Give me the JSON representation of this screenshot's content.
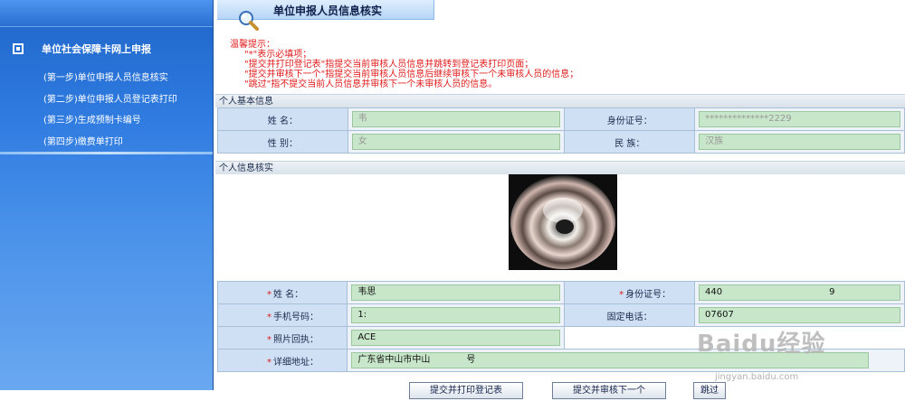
{
  "sidebar": {
    "heading": "单位社会保障卡网上申报",
    "items": [
      {
        "label": "(第一步)单位申报人员信息核实"
      },
      {
        "label": "(第二步)单位申报人员登记表打印"
      },
      {
        "label": "(第三步)生成预制卡编号"
      },
      {
        "label": "(第四步)缴费单打印"
      }
    ]
  },
  "header": {
    "title": "单位申报人员信息核实"
  },
  "tips": {
    "heading": "温馨提示：",
    "lines": [
      "\"*\"表示必填项；",
      "\"提交并打印登记表\"指提交当前审核人员信息并跳转到登记表打印页面；",
      "\"提交并审核下一个\"指提交当前审核人员信息后继续审核下一个未审核人员的信息；",
      "\"跳过\"指不提交当前人员信息并审核下一个未审核人员的信息。"
    ]
  },
  "basic": {
    "section_title": "个人基本信息",
    "name_label": "姓    名：",
    "name_value": "韦",
    "id_label": "身份证号：",
    "id_value": "**************2229",
    "gender_label": "性    别：",
    "gender_value": "女",
    "ethnic_label": "民    族：",
    "ethnic_value": "汉族"
  },
  "verify": {
    "section_title": "个人信息核实",
    "required_mark": "*",
    "name_label": "姓    名：",
    "name_value": "韦思",
    "id_label": "身份证号：",
    "id_value": "440",
    "id_value_tail": "9",
    "phone_label": "手机号码：",
    "phone_value": "1:",
    "landline_label": "固定电话：",
    "landline_value": "07607",
    "receipt_label": "照片回执：",
    "receipt_value": "ACE",
    "address_label": "详细地址：",
    "address_value": "广东省中山市中山",
    "address_tail": "号"
  },
  "buttons": {
    "submit_print": "提交并打印登记表",
    "submit_next": "提交并审核下一个",
    "skip": "跳过"
  },
  "watermark": {
    "brand": "Baidu经验",
    "url": "jingyan.baidu.com"
  }
}
